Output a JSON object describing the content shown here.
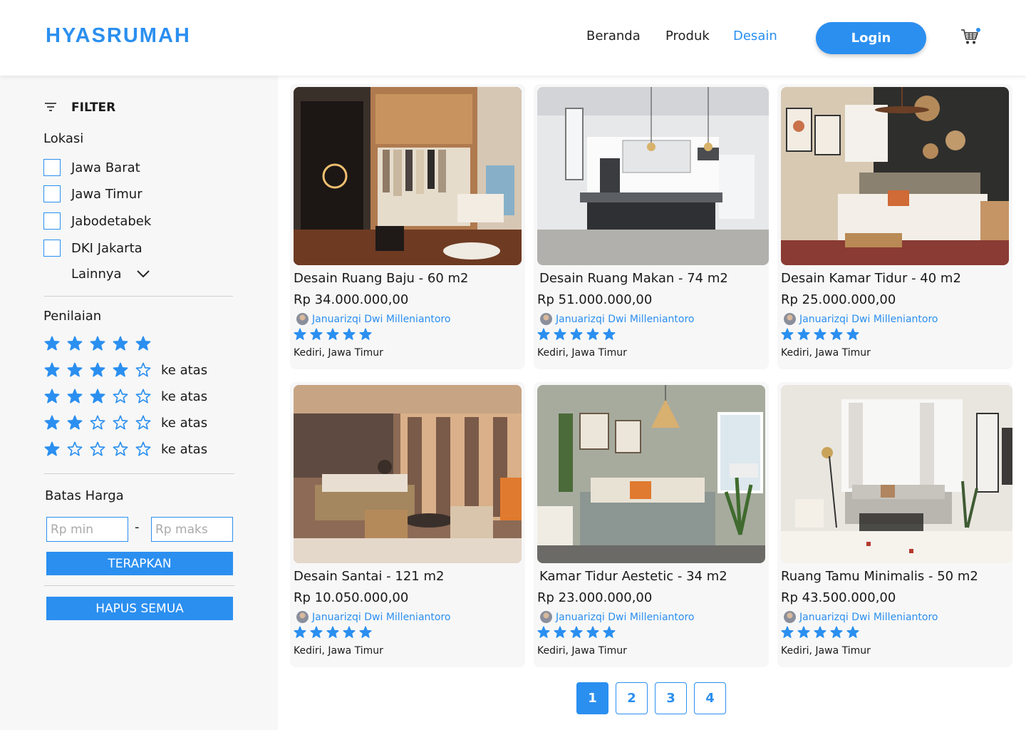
{
  "header": {
    "logo": "HYASRUMAH",
    "nav": [
      {
        "label": "Beranda",
        "active": false
      },
      {
        "label": "Produk",
        "active": false
      },
      {
        "label": "Desain",
        "active": true
      }
    ],
    "login_label": "Login",
    "cart_icon": "cart-icon",
    "cart_has_notification": true
  },
  "sidebar": {
    "filter_label": "FILTER",
    "location": {
      "title": "Lokasi",
      "options": [
        "Jawa Barat",
        "Jawa Timur",
        "Jabodetabek",
        "DKI Jakarta"
      ],
      "more_label": "Lainnya"
    },
    "rating": {
      "title": "Penilaian",
      "options": [
        {
          "stars": 5,
          "label": ""
        },
        {
          "stars": 4,
          "label": "ke atas"
        },
        {
          "stars": 3,
          "label": "ke atas"
        },
        {
          "stars": 2,
          "label": "ke atas"
        },
        {
          "stars": 1,
          "label": "ke atas"
        }
      ]
    },
    "price": {
      "title": "Batas Harga",
      "min_placeholder": "Rp min",
      "max_placeholder": "Rp maks",
      "separator": "-",
      "apply_label": "TERAPKAN",
      "clear_label": "HAPUS SEMUA"
    }
  },
  "products": [
    {
      "title": "Desain Ruang Baju - 60 m2",
      "price": "Rp 34.000.000,00",
      "author": "Januarizqi Dwi Milleniantoro",
      "rating": 5,
      "location": "Kediri, Jawa Timur",
      "image": "walk-in-closet"
    },
    {
      "title": "Desain Ruang Makan - 74 m2",
      "price": "Rp 51.000.000,00",
      "author": "Januarizqi Dwi Milleniantoro",
      "rating": 5,
      "location": "Kediri, Jawa Timur",
      "image": "dining-kitchen"
    },
    {
      "title": "Desain Kamar Tidur - 40 m2",
      "price": "Rp 25.000.000,00",
      "author": "Januarizqi Dwi Milleniantoro",
      "rating": 5,
      "location": "Kediri, Jawa Timur",
      "image": "boho-bedroom"
    },
    {
      "title": "Desain Santai - 121 m2",
      "price": "Rp 10.050.000,00",
      "author": "Januarizqi Dwi Milleniantoro",
      "rating": 5,
      "location": "Kediri, Jawa Timur",
      "image": "lounge"
    },
    {
      "title": "Kamar Tidur Aestetic - 34 m2",
      "price": "Rp 23.000.000,00",
      "author": "Januarizqi Dwi Milleniantoro",
      "rating": 5,
      "location": "Kediri, Jawa Timur",
      "image": "plant-bedroom"
    },
    {
      "title": "Ruang Tamu Minimalis - 50 m2",
      "price": "Rp 43.500.000,00",
      "author": "Januarizqi Dwi Milleniantoro",
      "rating": 5,
      "location": "Kediri, Jawa Timur",
      "image": "living-room"
    }
  ],
  "pagination": {
    "pages": [
      "1",
      "2",
      "3",
      "4"
    ],
    "current": "1"
  },
  "colors": {
    "accent": "#2b8ff0",
    "panel": "#f7f7f7",
    "text": "#1a1a1a"
  }
}
